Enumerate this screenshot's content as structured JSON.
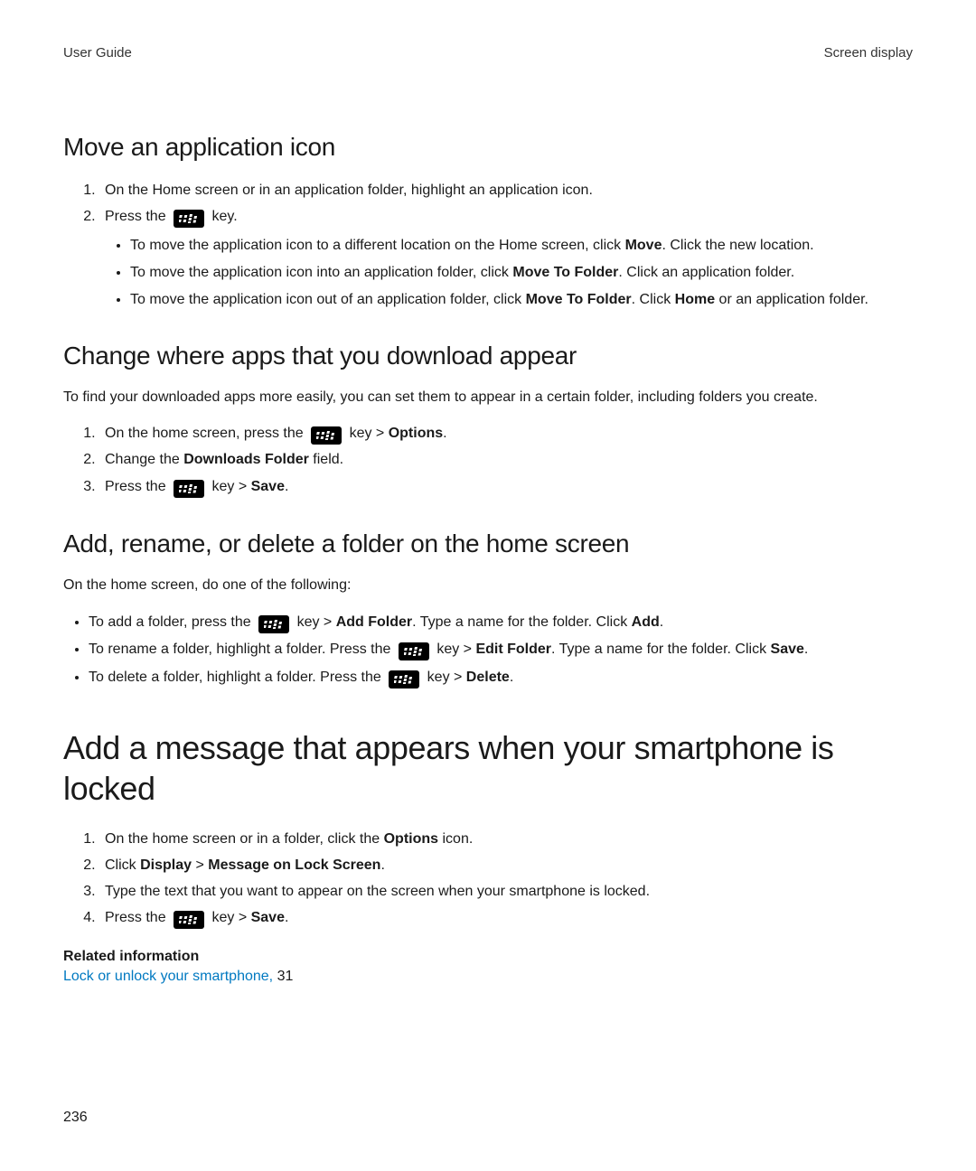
{
  "header": {
    "left": "User Guide",
    "right": "Screen display"
  },
  "page_number": "236",
  "gt": " > ",
  "key_word": " key",
  "press_the": "Press the ",
  "s1": {
    "title": "Move an application icon",
    "step1": "On the Home screen or in an application folder, highlight an application icon.",
    "step2_suffix": ".",
    "b1a": "To move the application icon to a different location on the Home screen, click ",
    "b1b": "Move",
    "b1c": ". Click the new location.",
    "b2a": "To move the application icon into an application folder, click ",
    "b2b": "Move To Folder",
    "b2c": ". Click an application folder.",
    "b3a": "To move the application icon out of an application folder, click ",
    "b3b": "Move To Folder",
    "b3c": ". Click ",
    "b3d": "Home",
    "b3e": " or an application folder."
  },
  "s2": {
    "title": "Change where apps that you download appear",
    "intro": "To find your downloaded apps more easily, you can set them to appear in a certain folder, including folders you create.",
    "step1a": "On the home screen, press the ",
    "step1b": "Options",
    "step1c": ".",
    "step2a": "Change the ",
    "step2b": "Downloads Folder",
    "step2c": " field.",
    "step3b": "Save",
    "step3c": "."
  },
  "s3": {
    "title": "Add, rename, or delete a folder on the home screen",
    "intro": "On the home screen, do one of the following:",
    "b1a": "To add a folder, press the ",
    "b1b": "Add Folder",
    "b1c": ". Type a name for the folder. Click ",
    "b1d": "Add",
    "b1e": ".",
    "b2a": "To rename a folder, highlight a folder. Press the ",
    "b2b": "Edit Folder",
    "b2c": ". Type a name for the folder. Click ",
    "b2d": "Save",
    "b2e": ".",
    "b3a": "To delete a folder, highlight a folder. Press the ",
    "b3b": "Delete",
    "b3c": "."
  },
  "s4": {
    "title": "Add a message that appears when your smartphone is locked",
    "step1a": "On the home screen or in a folder, click the ",
    "step1b": "Options",
    "step1c": " icon.",
    "step2a": "Click ",
    "step2b": "Display",
    "step2c": "Message on Lock Screen",
    "step2d": ".",
    "step3": "Type the text that you want to appear on the screen when your smartphone is locked.",
    "step4b": "Save",
    "step4c": "."
  },
  "related": {
    "heading": "Related information",
    "link_text": "Lock or unlock your smartphone, ",
    "page": "31"
  }
}
